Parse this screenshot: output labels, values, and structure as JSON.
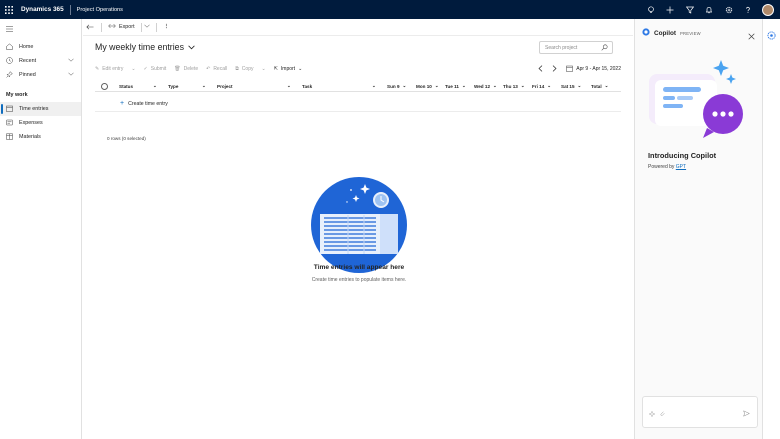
{
  "topbar": {
    "brand": "Dynamics 365",
    "app_name": "Project Operations",
    "icons": [
      "lightbulb-icon",
      "plus-icon",
      "filter-icon",
      "bell-icon",
      "gear-icon",
      "help-icon",
      "avatar"
    ]
  },
  "nav": {
    "items": [
      {
        "label": "Home",
        "icon": "home-icon"
      },
      {
        "label": "Recent",
        "icon": "clock-icon"
      },
      {
        "label": "Pinned",
        "icon": "pin-icon"
      }
    ],
    "section_title": "My work",
    "work_items": [
      {
        "label": "Time entries",
        "icon": "calendar-icon",
        "selected": true
      },
      {
        "label": "Expenses",
        "icon": "receipt-icon",
        "selected": false
      },
      {
        "label": "Materials",
        "icon": "box-icon",
        "selected": false
      }
    ]
  },
  "commandbar": {
    "export_label": "Export",
    "more_label": "⋮"
  },
  "view": {
    "title": "My weekly time entries",
    "search_placeholder": "Search project"
  },
  "actions": {
    "edit": "Edit entry",
    "submit": "Submit",
    "delete": "Delete",
    "recall": "Recall",
    "copy": "Copy",
    "import": "Import",
    "date_range": "Apr 9 - Apr 15, 2022"
  },
  "grid": {
    "columns": [
      "Status",
      "Type",
      "Project",
      "Task",
      "Sun 9",
      "Mon 10",
      "Tue 11",
      "Wed 12",
      "Thu 13",
      "Fri 14",
      "Sat 15",
      "Total"
    ],
    "create_label": "Create time entry",
    "rows_info": "0 rows (0 selected)"
  },
  "empty": {
    "title": "Time entries will appear here",
    "subtitle": "Create time entries to populate items here."
  },
  "copilot": {
    "title": "Copilot",
    "preview": "PREVIEW",
    "intro": "Introducing Copilot",
    "powered_by": "Powered by",
    "gpt": "GPT"
  },
  "colors": {
    "topbar": "#001b3d",
    "accent": "#0f6cbd",
    "empty_circle": "#1f65d6"
  }
}
